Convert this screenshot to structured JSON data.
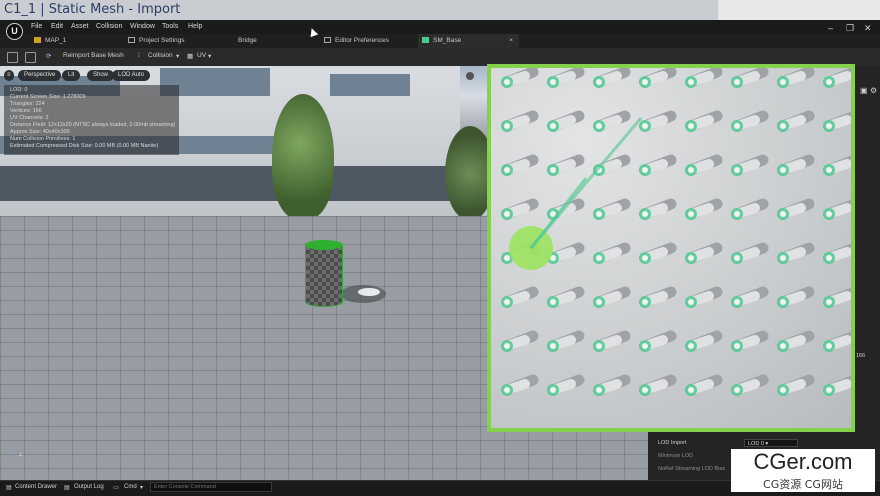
{
  "window": {
    "title": "C1_1 | Static Mesh - Import"
  },
  "menu": [
    "File",
    "Edit",
    "Asset",
    "Collision",
    "Window",
    "Tools",
    "Help"
  ],
  "tabs": [
    {
      "label": "MAP_1"
    },
    {
      "label": "Project Settings"
    },
    {
      "label": "Bridge"
    },
    {
      "label": "Editor Preferences"
    },
    {
      "label": "SM_Base",
      "close": "×"
    }
  ],
  "toolbar": {
    "reimport_label": "Reimport Base Mesh",
    "collision_label": "Collision",
    "uv_label": "UV"
  },
  "viewport": {
    "buttons": [
      "Perspective",
      "Lit",
      "Show",
      "LOD Auto"
    ],
    "info_lines": [
      "LOD: 0",
      "Current Screen Size: 1.278009",
      "Triangles: 224",
      "Vertices: 166",
      "UV Channels: 2",
      "Distance Field: 12x12x20 (NTSC always loaded, 0.00mb streaming)",
      "Approx Size: 40x40x100",
      "Num Collision Primitives: 1",
      "Estimated Compressed Disk Size: 0.00 MB (0.00 MB Nanite)"
    ],
    "axes_label": "z"
  },
  "details_panel": {
    "lod_label": "LOD Import",
    "lod_value": "LOD 0",
    "min_lod_label": "Minimum LOD",
    "streaming_label": "NoRef Streaming LOD Bias",
    "side_value": "166"
  },
  "statusbar": {
    "content_drawer": "Content Drawer",
    "output_log": "Output Log",
    "cmd": "Cmd",
    "console_placeholder": "Enter Console Command"
  },
  "watermark": {
    "line1": "CGer.com",
    "line2": "CG资源 CG网站"
  },
  "colors": {
    "overlay_border": "#86d14c",
    "socket_green": "#4fc892",
    "mesh_green": "#2fb12f"
  }
}
